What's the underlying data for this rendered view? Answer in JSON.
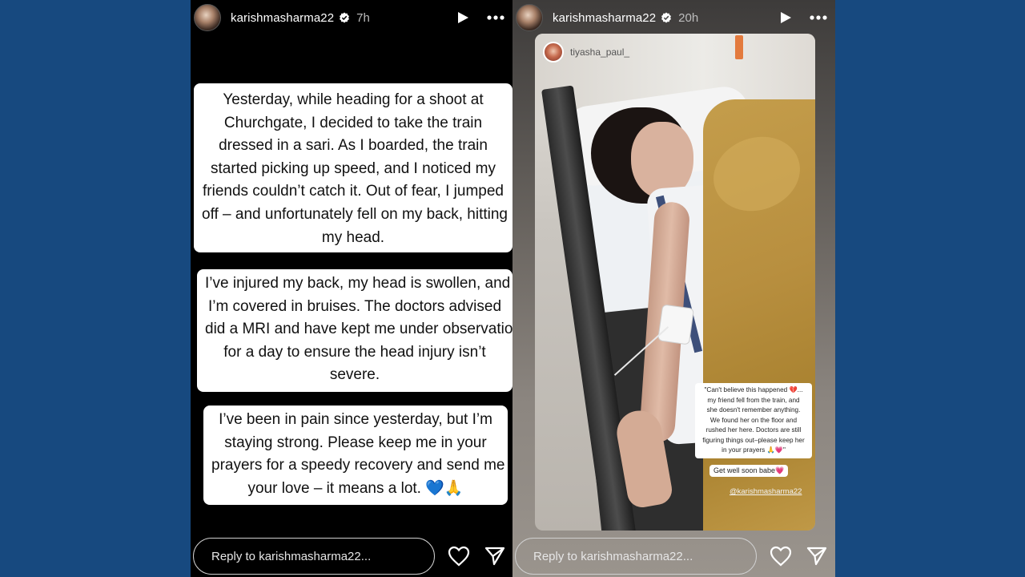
{
  "left_story": {
    "username": "karishmasharma22",
    "time": "7h",
    "paragraph1": [
      "Yesterday, while heading for a shoot at",
      "Churchgate, I decided to take the train",
      "dressed in a sari. As I boarded, the train",
      "started picking up speed, and I noticed my",
      "friends couldn’t catch it. Out of fear, I jumped",
      "off – and unfortunately fell on my back, hitting",
      "my head."
    ],
    "paragraph2": [
      "I’ve injured my back, my head is swollen, and",
      "I’m covered in bruises. The doctors advised",
      "did a MRI and have kept me under observation",
      "for a day to ensure the head injury isn’t",
      "severe."
    ],
    "paragraph3": [
      "I’ve been in pain since yesterday, but I’m",
      "staying strong. Please keep me in your",
      "prayers for a speedy recovery and send me",
      "your love – it means a lot. 💙🙏"
    ],
    "reply_placeholder": "Reply to karishmasharma22..."
  },
  "right_story": {
    "username": "karishmasharma22",
    "time": "20h",
    "reshared_from": "tiyasha_paul_",
    "caption_lines": [
      "\"Can't believe this happened 💔...",
      "my friend fell from the train, and",
      "she doesn't remember anything.",
      "We found her on the floor and",
      "rushed her here. Doctors are still",
      "figuring things out–please keep her",
      "in your prayers 🙏💗\""
    ],
    "get_well": "Get well soon babe💗",
    "mention": "@karishmasharma22",
    "reply_placeholder": "Reply to karishmasharma22..."
  },
  "colors": {
    "page_background": "#17497f",
    "story_background": "#000000",
    "verified_badge": "#ffffff"
  },
  "icons": {
    "verified": "verified-badge-icon",
    "play": "play-icon",
    "more": "more-dots-icon",
    "like": "heart-icon",
    "send": "send-icon"
  }
}
